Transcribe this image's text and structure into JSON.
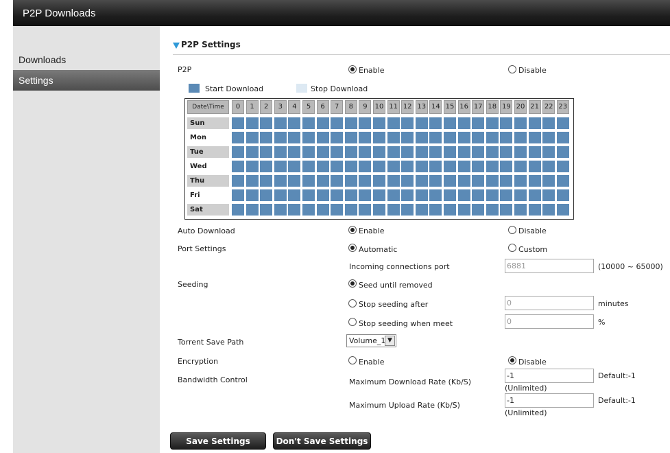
{
  "header": {
    "title": "P2P Downloads"
  },
  "sidebar": {
    "items": [
      {
        "label": "Downloads"
      },
      {
        "label": "Settings"
      }
    ]
  },
  "section": {
    "title": "P2P Settings"
  },
  "p2p": {
    "label": "P2P",
    "enable": "Enable",
    "disable": "Disable",
    "selected": "Enable"
  },
  "legend": {
    "start": "Start Download",
    "stop": "Stop Download",
    "start_color": "#5b8ab6",
    "stop_color": "#dde9f3"
  },
  "schedule": {
    "corner": "Date\\Time",
    "hours": [
      "0",
      "1",
      "2",
      "3",
      "4",
      "5",
      "6",
      "7",
      "8",
      "9",
      "10",
      "11",
      "12",
      "13",
      "14",
      "15",
      "16",
      "17",
      "18",
      "19",
      "20",
      "21",
      "22",
      "23"
    ],
    "days": [
      "Sun",
      "Mon",
      "Tue",
      "Wed",
      "Thu",
      "Fri",
      "Sat"
    ]
  },
  "auto_download": {
    "label": "Auto Download",
    "enable": "Enable",
    "disable": "Disable",
    "selected": "Enable"
  },
  "port": {
    "label": "Port Settings",
    "automatic": "Automatic",
    "custom": "Custom",
    "selected": "Automatic",
    "incoming_label": "Incoming connections port",
    "incoming_value": "6881",
    "range": "(10000 ~ 65000)"
  },
  "seeding": {
    "label": "Seeding",
    "until_removed": "Seed until removed",
    "stop_after": "Stop seeding after",
    "stop_after_value": "0",
    "stop_after_unit": "minutes",
    "stop_meet": "Stop seeding when meet",
    "stop_meet_value": "0",
    "stop_meet_unit": "%",
    "selected": "Seed until removed"
  },
  "torrent": {
    "label": "Torrent Save Path",
    "value": "Volume_1"
  },
  "encryption": {
    "label": "Encryption",
    "enable": "Enable",
    "disable": "Disable",
    "selected": "Disable"
  },
  "bandwidth": {
    "label": "Bandwidth Control",
    "download_label": "Maximum Download Rate (Kb/S)",
    "download_value": "-1",
    "download_default": "Default:-1",
    "upload_label": "Maximum Upload Rate (Kb/S)",
    "upload_value": "-1",
    "upload_default": "Default:-1",
    "unlimited": "(Unlimited)"
  },
  "buttons": {
    "save": "Save Settings",
    "dont_save": "Don't Save Settings"
  }
}
